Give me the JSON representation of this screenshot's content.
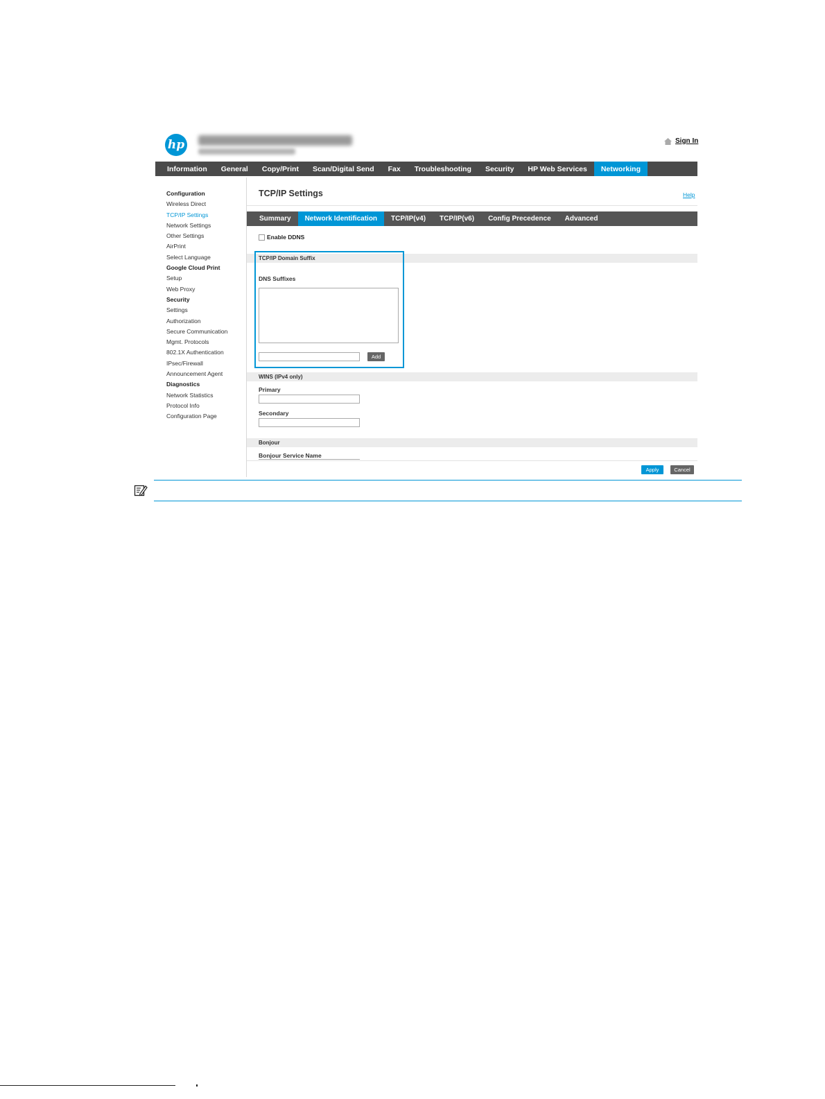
{
  "header": {
    "logo_text": "hp",
    "sign_in_label": "Sign In"
  },
  "top_nav": [
    {
      "label": "Information",
      "active": false
    },
    {
      "label": "General",
      "active": false
    },
    {
      "label": "Copy/Print",
      "active": false
    },
    {
      "label": "Scan/Digital Send",
      "active": false
    },
    {
      "label": "Fax",
      "active": false
    },
    {
      "label": "Troubleshooting",
      "active": false
    },
    {
      "label": "Security",
      "active": false
    },
    {
      "label": "HP Web Services",
      "active": false
    },
    {
      "label": "Networking",
      "active": true
    }
  ],
  "sidebar": [
    {
      "label": "Configuration",
      "type": "head"
    },
    {
      "label": "Wireless Direct",
      "type": "item"
    },
    {
      "label": "TCP/IP Settings",
      "type": "active"
    },
    {
      "label": "Network Settings",
      "type": "item"
    },
    {
      "label": "Other Settings",
      "type": "item"
    },
    {
      "label": "AirPrint",
      "type": "item"
    },
    {
      "label": "Select Language",
      "type": "item"
    },
    {
      "label": "Google Cloud Print",
      "type": "head"
    },
    {
      "label": "Setup",
      "type": "item"
    },
    {
      "label": "Web Proxy",
      "type": "item"
    },
    {
      "label": "Security",
      "type": "head"
    },
    {
      "label": "Settings",
      "type": "item"
    },
    {
      "label": "Authorization",
      "type": "item"
    },
    {
      "label": "Secure Communication",
      "type": "item"
    },
    {
      "label": "Mgmt. Protocols",
      "type": "item"
    },
    {
      "label": "802.1X Authentication",
      "type": "item"
    },
    {
      "label": "IPsec/Firewall",
      "type": "item"
    },
    {
      "label": "Announcement Agent",
      "type": "item"
    },
    {
      "label": "Diagnostics",
      "type": "head"
    },
    {
      "label": "Network Statistics",
      "type": "item"
    },
    {
      "label": "Protocol Info",
      "type": "item"
    },
    {
      "label": "Configuration Page",
      "type": "item"
    }
  ],
  "main": {
    "title": "TCP/IP Settings",
    "help_label": "Help",
    "tabs": [
      {
        "label": "Summary",
        "active": false
      },
      {
        "label": "Network Identification",
        "active": true
      },
      {
        "label": "TCP/IP(v4)",
        "active": false
      },
      {
        "label": "TCP/IP(v6)",
        "active": false
      },
      {
        "label": "Config Precedence",
        "active": false
      },
      {
        "label": "Advanced",
        "active": false
      }
    ],
    "enable_ddns_label": "Enable DDNS",
    "domain_suffix_section": "TCP/IP Domain Suffix",
    "dns_suffixes_label": "DNS Suffixes",
    "add_label": "Add",
    "wins_section": "WINS (IPv4 only)",
    "primary_label": "Primary",
    "secondary_label": "Secondary",
    "bonjour_section": "Bonjour",
    "bonjour_service_name_label": "Bonjour Service Name",
    "apply_label": "Apply",
    "cancel_label": "Cancel"
  },
  "colors": {
    "accent": "#0096d6",
    "nav_bg": "#4a4a4a"
  },
  "icons": {
    "home": "home-icon",
    "note": "note-icon",
    "logo": "hp-logo"
  }
}
